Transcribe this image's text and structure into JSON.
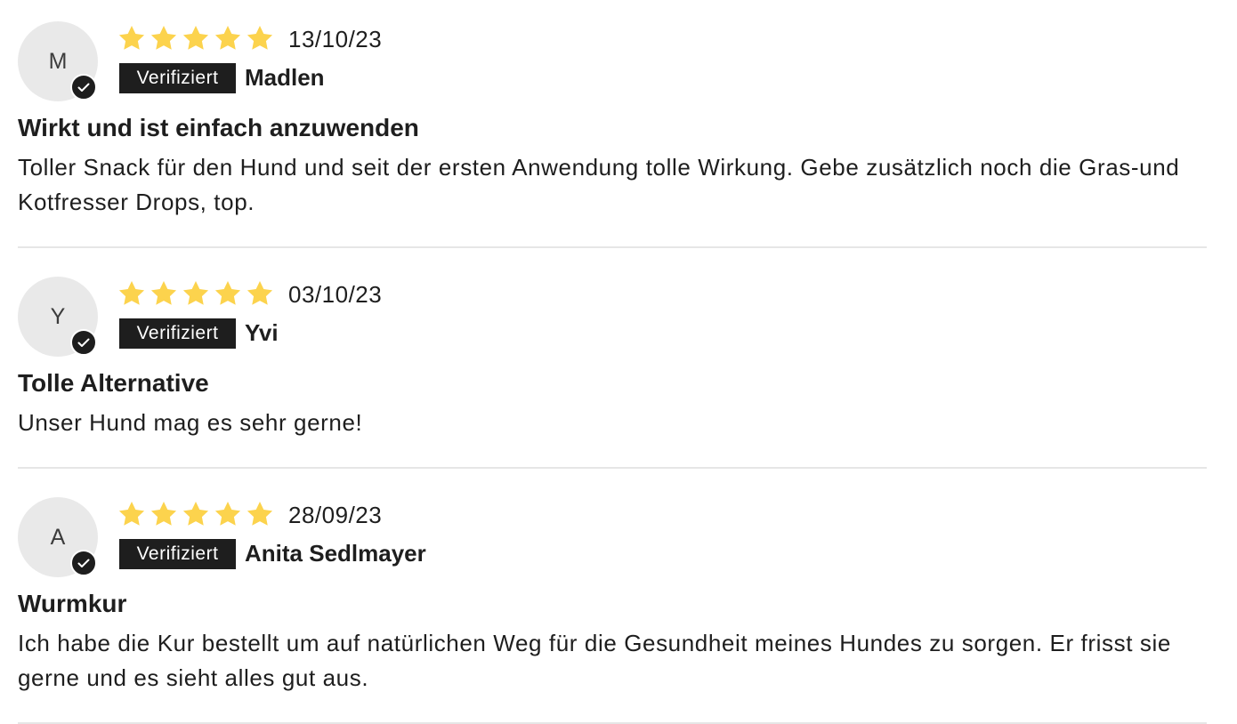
{
  "colors": {
    "star": "#fcd34d",
    "badge_bg": "#1e1e1e",
    "avatar_bg": "#e9e9e9",
    "divider": "#e6e6e6"
  },
  "reviews": [
    {
      "avatar_initial": "M",
      "rating": 5,
      "date": "13/10/23",
      "badge": "Verifiziert",
      "author": "Madlen",
      "title": "Wirkt und ist einfach anzuwenden",
      "body": "Toller Snack für den Hund und seit der ersten Anwendung tolle Wirkung. Gebe zusätzlich noch die Gras-und Kotfresser Drops, top."
    },
    {
      "avatar_initial": "Y",
      "rating": 5,
      "date": "03/10/23",
      "badge": "Verifiziert",
      "author": "Yvi",
      "title": "Tolle Alternative",
      "body": "Unser Hund mag es sehr gerne!"
    },
    {
      "avatar_initial": "A",
      "rating": 5,
      "date": "28/09/23",
      "badge": "Verifiziert",
      "author": "Anita Sedlmayer",
      "title": "Wurmkur",
      "body": "Ich habe die Kur bestellt um auf natürlichen Weg für die Gesundheit meines Hundes zu sorgen. Er frisst sie gerne und es sieht alles gut aus."
    }
  ]
}
